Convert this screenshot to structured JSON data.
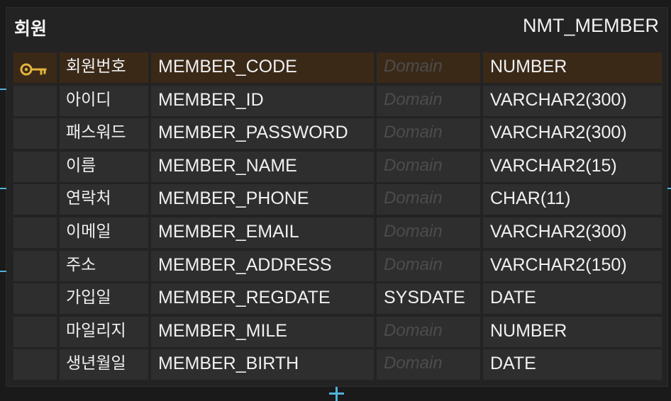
{
  "entity": {
    "logical_name": "회원",
    "physical_name": "NMT_MEMBER",
    "columns": [
      {
        "logical": "회원번호",
        "physical": "MEMBER_CODE",
        "default": "",
        "domain_placeholder": "Domain",
        "type": "NUMBER",
        "primary_key": true
      },
      {
        "logical": "아이디",
        "physical": "MEMBER_ID",
        "default": "",
        "domain_placeholder": "Domain",
        "type": "VARCHAR2(300)",
        "primary_key": false
      },
      {
        "logical": "패스워드",
        "physical": "MEMBER_PASSWORD",
        "default": "",
        "domain_placeholder": "Domain",
        "type": "VARCHAR2(300)",
        "primary_key": false
      },
      {
        "logical": "이름",
        "physical": "MEMBER_NAME",
        "default": "",
        "domain_placeholder": "Domain",
        "type": "VARCHAR2(15)",
        "primary_key": false
      },
      {
        "logical": "연락처",
        "physical": "MEMBER_PHONE",
        "default": "",
        "domain_placeholder": "Domain",
        "type": "CHAR(11)",
        "primary_key": false
      },
      {
        "logical": "이메일",
        "physical": "MEMBER_EMAIL",
        "default": "",
        "domain_placeholder": "Domain",
        "type": "VARCHAR2(300)",
        "primary_key": false
      },
      {
        "logical": "주소",
        "physical": "MEMBER_ADDRESS",
        "default": "",
        "domain_placeholder": "Domain",
        "type": "VARCHAR2(150)",
        "primary_key": false
      },
      {
        "logical": "가입일",
        "physical": "MEMBER_REGDATE",
        "default": "SYSDATE",
        "domain_placeholder": "Domain",
        "type": "DATE",
        "primary_key": false
      },
      {
        "logical": "마일리지",
        "physical": "MEMBER_MILE",
        "default": "",
        "domain_placeholder": "Domain",
        "type": "NUMBER",
        "primary_key": false
      },
      {
        "logical": "생년월일",
        "physical": "MEMBER_BIRTH",
        "default": "",
        "domain_placeholder": "Domain",
        "type": "DATE",
        "primary_key": false
      }
    ]
  },
  "icons": {
    "primary_key": "key-icon",
    "key_color": "#e3b53c",
    "connector_color": "#4fb3d9"
  }
}
